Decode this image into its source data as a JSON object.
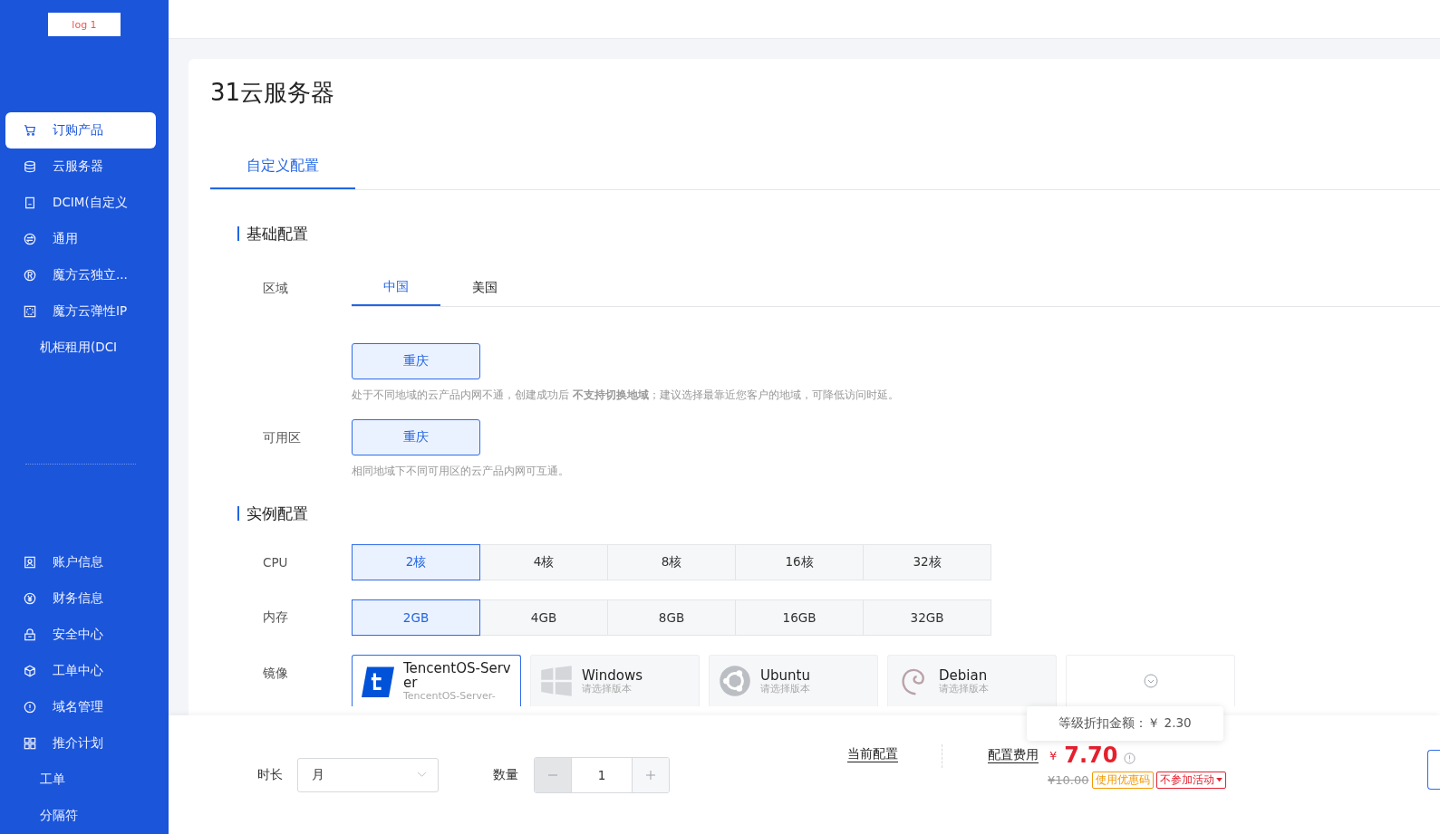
{
  "sidebar": {
    "logo": "log 1",
    "items": [
      {
        "label": "订购产品",
        "kind": "icon",
        "selected": true
      },
      {
        "label": "云服务器",
        "kind": "icon",
        "selected": false
      },
      {
        "label": "DCIM(自定义",
        "kind": "icon",
        "selected": false
      },
      {
        "label": "通用",
        "kind": "icon",
        "selected": false
      },
      {
        "label": "魔方云独立...",
        "kind": "icon",
        "selected": false
      },
      {
        "label": "魔方云弹性IP",
        "kind": "icon",
        "selected": false
      },
      {
        "label": "机柜租用(DCI",
        "kind": "text",
        "selected": false
      }
    ],
    "bottom_items": [
      {
        "label": "账户信息",
        "kind": "icon"
      },
      {
        "label": "财务信息",
        "kind": "icon"
      },
      {
        "label": "安全中心",
        "kind": "icon"
      },
      {
        "label": "工单中心",
        "kind": "icon"
      },
      {
        "label": "域名管理",
        "kind": "icon"
      },
      {
        "label": "推介计划",
        "kind": "icon"
      },
      {
        "label": "工单",
        "kind": "text"
      },
      {
        "label": "分隔符",
        "kind": "text"
      }
    ]
  },
  "page_title": "31云服务器",
  "tabs": [
    {
      "label": "自定义配置",
      "selected": true
    }
  ],
  "basic": {
    "title": "基础配置",
    "region": {
      "label": "区域",
      "tabs": [
        {
          "label": "中国",
          "selected": true
        },
        {
          "label": "美国",
          "selected": false
        }
      ],
      "cities": [
        {
          "label": "重庆",
          "selected": true
        }
      ],
      "hint": "处于不同地域的云产品内网不通，创建成功后 **不支持切换地域**；建议选择最靠近您客户的地域，可降低访问时延。"
    },
    "zone": {
      "label": "可用区",
      "options": [
        {
          "label": "重庆",
          "selected": true
        }
      ],
      "hint": "相同地域下不同可用区的云产品内网可互通。"
    }
  },
  "instance": {
    "title": "实例配置",
    "cpu": {
      "label": "CPU",
      "options": [
        {
          "label": "2核",
          "selected": true
        },
        {
          "label": "4核",
          "selected": false
        },
        {
          "label": "8核",
          "selected": false
        },
        {
          "label": "16核",
          "selected": false
        },
        {
          "label": "32核",
          "selected": false
        }
      ]
    },
    "memory": {
      "label": "内存",
      "options": [
        {
          "label": "2GB",
          "selected": true
        },
        {
          "label": "4GB",
          "selected": false
        },
        {
          "label": "8GB",
          "selected": false
        },
        {
          "label": "16GB",
          "selected": false
        },
        {
          "label": "32GB",
          "selected": false
        }
      ]
    },
    "image": {
      "label": "镜像",
      "options": [
        {
          "name": "TencentOS-Server",
          "sub": "TencentOS-Server-",
          "kind": "tencent",
          "selected": true
        },
        {
          "name": "Windows",
          "sub": "请选择版本",
          "kind": "windows",
          "selected": false
        },
        {
          "name": "Ubuntu",
          "sub": "请选择版本",
          "kind": "ubuntu",
          "selected": false
        },
        {
          "name": "Debian",
          "sub": "请选择版本",
          "kind": "debian",
          "selected": false
        },
        {
          "kind": "more",
          "selected": false
        }
      ]
    }
  },
  "footer": {
    "duration": {
      "label": "时长",
      "value": "月"
    },
    "quantity": {
      "label": "数量",
      "value": "1",
      "minus_disabled": true
    },
    "current_config": "当前配置",
    "fee_label": "配置费用",
    "currency": "¥",
    "price": "7.70",
    "original_price": "¥10.00",
    "coupon": "使用优惠码",
    "activity": "不参加活动",
    "tooltip": "等级折扣金额：￥ 2.30"
  }
}
